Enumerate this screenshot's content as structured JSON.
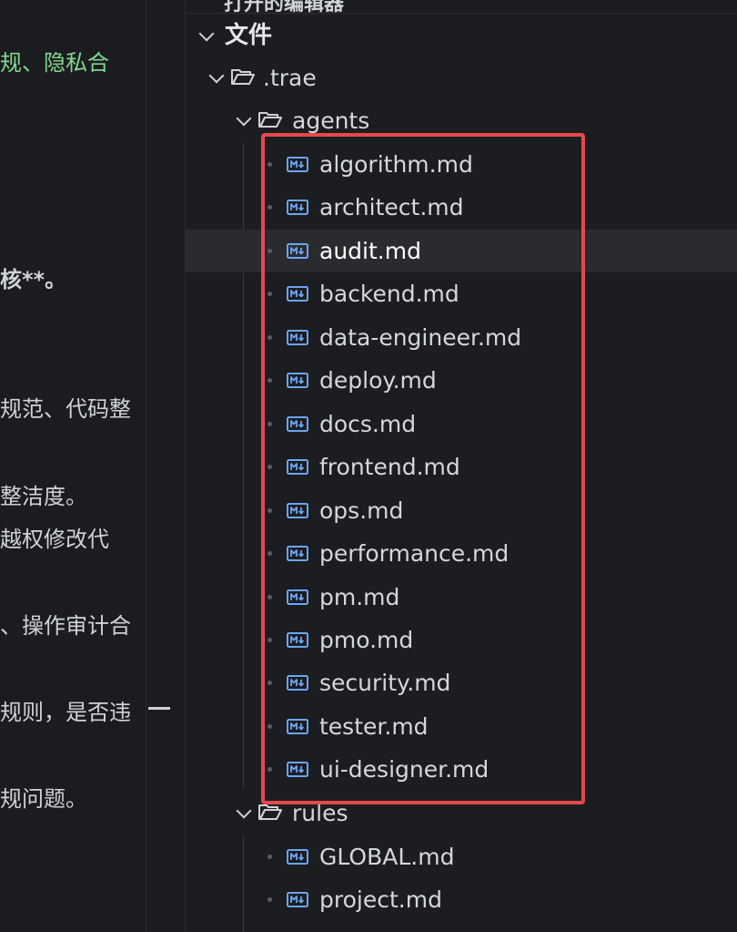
{
  "editor": {
    "lines": [
      {
        "text": "规、隐私合",
        "style": "green"
      },
      {
        "text": "核**。",
        "style": "bold"
      },
      {
        "text": "规范、代码整",
        "style": ""
      },
      {
        "text": "整洁度。",
        "style": ""
      },
      {
        "text": "越权修改代",
        "style": ""
      },
      {
        "text": "、操作审计合",
        "style": ""
      },
      {
        "text": "规则，是否违",
        "style": ""
      },
      {
        "text": "规问题。",
        "style": ""
      }
    ]
  },
  "explorer": {
    "partial_title": "打开的编辑器",
    "section_label": "文件",
    "root_folder": ".trae",
    "agents_folder": "agents",
    "agents_files": [
      "algorithm.md",
      "architect.md",
      "audit.md",
      "backend.md",
      "data-engineer.md",
      "deploy.md",
      "docs.md",
      "frontend.md",
      "ops.md",
      "performance.md",
      "pm.md",
      "pmo.md",
      "security.md",
      "tester.md",
      "ui-designer.md"
    ],
    "active_file": "audit.md",
    "rules_folder": "rules",
    "rules_files": [
      "GLOBAL.md",
      "project.md"
    ]
  },
  "icons": {
    "chevron": "chevron-down-icon",
    "folder": "folder-open-icon",
    "markdown": "markdown-file-icon"
  },
  "colors": {
    "highlight_box": "#e5484d",
    "markdown_icon": "#6aa6f2",
    "green_text": "#7fd88f"
  }
}
